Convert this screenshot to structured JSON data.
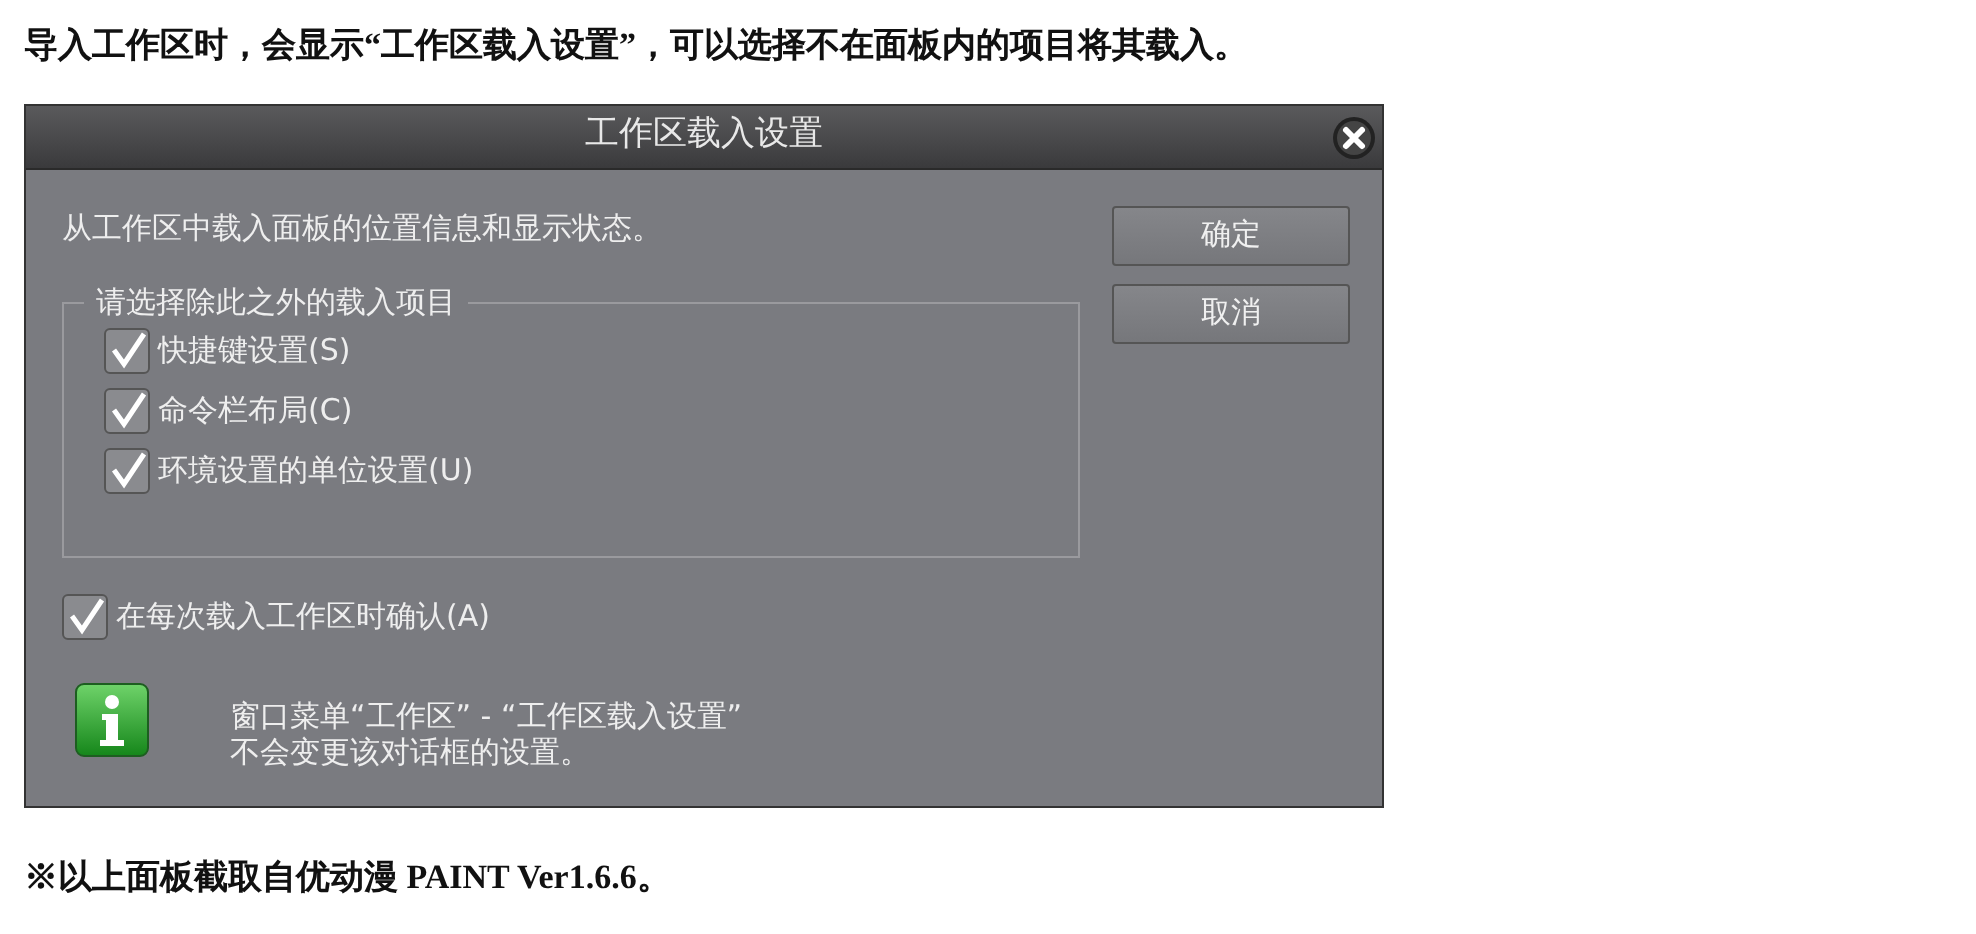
{
  "heading": "导入工作区时，会显示“工作区载入设置”，可以选择不在面板内的项目将其载入。",
  "dialog": {
    "title": "工作区载入设置",
    "description": "从工作区中载入面板的位置信息和显示状态。",
    "buttons": [
      "确定",
      "取消"
    ],
    "group": {
      "legend": "请选择除此之外的载入项目",
      "options": [
        {
          "label": "快捷键设置(S)",
          "checked": true
        },
        {
          "label": "命令栏布局(C)",
          "checked": true
        },
        {
          "label": "环境设置的单位设置(U)",
          "checked": true
        }
      ]
    },
    "confirm": {
      "label": "在每次载入工作区时确认(A)",
      "checked": true
    },
    "info": [
      "窗口菜单“工作区” - “工作区载入设置”",
      "不会变更该对话框的设置。"
    ]
  },
  "footnote": "※以上面板截取自优动漫 PAINT Ver1.6.6。"
}
